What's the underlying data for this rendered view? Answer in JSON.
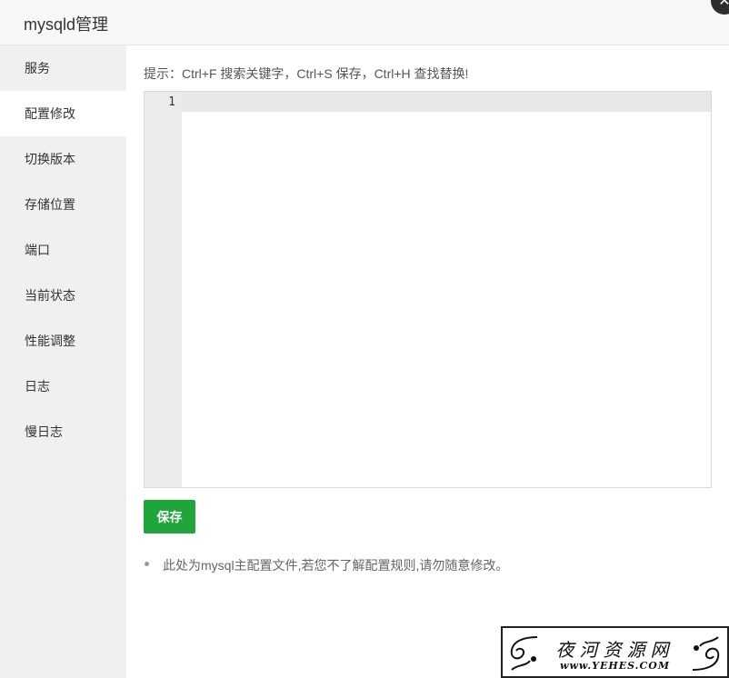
{
  "dialog": {
    "title": "mysqld管理",
    "close_symbol": "✕"
  },
  "sidebar": {
    "items": [
      {
        "label": "服务"
      },
      {
        "label": "配置修改",
        "active": true
      },
      {
        "label": "切换版本"
      },
      {
        "label": "存储位置"
      },
      {
        "label": "端口"
      },
      {
        "label": "当前状态"
      },
      {
        "label": "性能调整"
      },
      {
        "label": "日志"
      },
      {
        "label": "慢日志"
      }
    ]
  },
  "content": {
    "hint": "提示：Ctrl+F 搜索关键字，Ctrl+S 保存，Ctrl+H 查找替换!",
    "editor": {
      "line_numbers": [
        "1"
      ],
      "text": ""
    },
    "save_label": "保存",
    "notes": [
      "此处为mysql主配置文件,若您不了解配置规则,请勿随意修改。"
    ]
  },
  "watermark": {
    "top": "夜河资源网",
    "bottom": "www.YEHES.COM"
  },
  "colors": {
    "accent": "#20a53a",
    "sidebar_bg": "#f0f0f0",
    "titlebar_bg": "#f8f8f8"
  },
  "icons": {
    "close": "close-icon",
    "bullet": "bullet-icon"
  }
}
